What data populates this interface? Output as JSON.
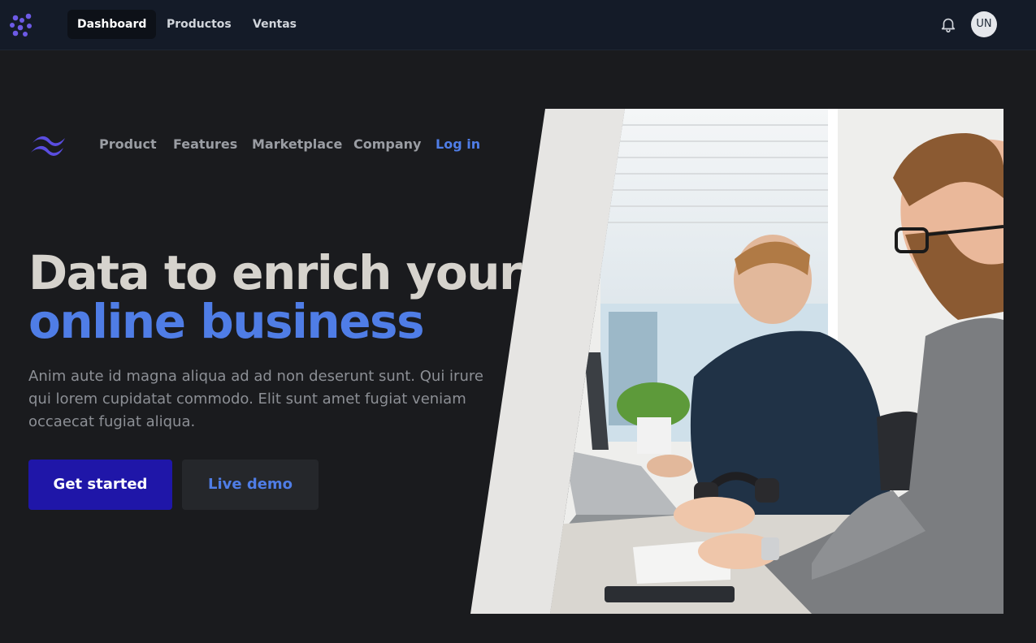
{
  "topbar": {
    "logo_icon": "dots-logo-icon",
    "tabs": [
      {
        "label": "Dashboard",
        "active": true
      },
      {
        "label": "Productos",
        "active": false
      },
      {
        "label": "Ventas",
        "active": false
      }
    ],
    "notification_icon": "bell-icon",
    "avatar_initials": "UN"
  },
  "hero": {
    "logo_icon": "waves-logo-icon",
    "nav": [
      "Product",
      "Features",
      "Marketplace",
      "Company"
    ],
    "login_label": "Log in",
    "headline_line1": "Data to enrich your",
    "headline_line2": "online business",
    "description": "Anim aute id magna aliqua ad ad non deserunt sunt. Qui irure qui lorem cupidatat commodo. Elit sunt amet fugiat veniam occaecat fugiat aliqua.",
    "primary_button": "Get started",
    "secondary_button": "Live demo",
    "image_icon": "office-photo-image"
  },
  "colors": {
    "accent": "#4f7de6",
    "primary_button": "#1f16a8",
    "background": "#1a1b1e",
    "topbar": "#141b28"
  }
}
